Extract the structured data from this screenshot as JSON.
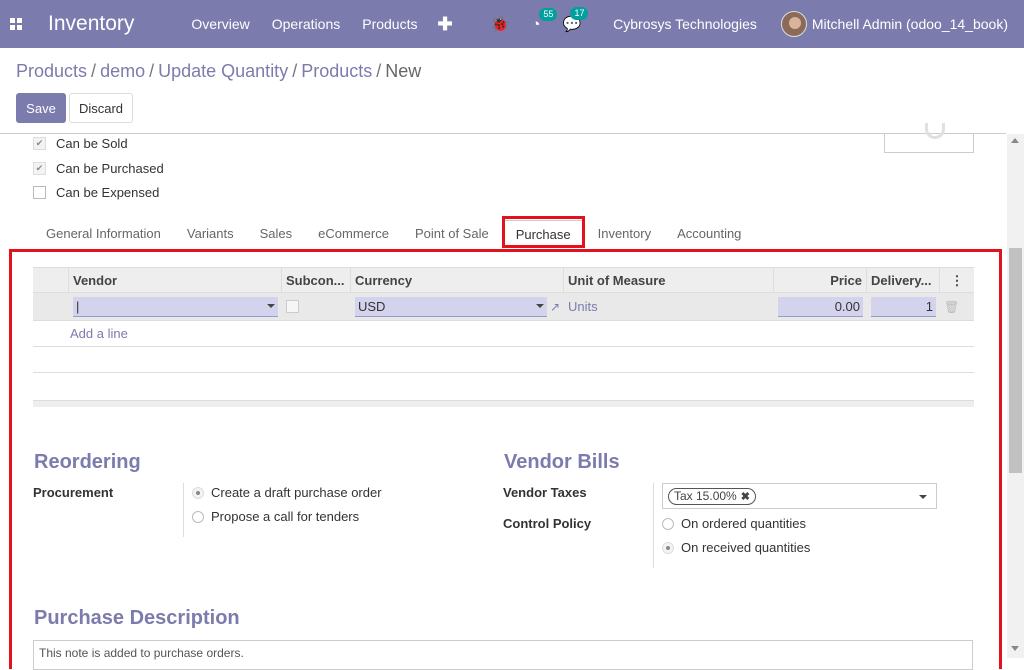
{
  "navbar": {
    "app_name": "Inventory",
    "menu": [
      "Overview",
      "Operations",
      "Products"
    ],
    "plus": "✚",
    "activity_count": "55",
    "messages_count": "17",
    "company": "Cybrosys Technologies",
    "user": "Mitchell Admin (odoo_14_book)"
  },
  "breadcrumb": [
    "Products",
    "demo",
    "Update Quantity",
    "Products",
    "New"
  ],
  "buttons": {
    "save": "Save",
    "discard": "Discard"
  },
  "checkboxes": [
    {
      "label": "Can be Sold",
      "checked": true
    },
    {
      "label": "Can be Purchased",
      "checked": true
    },
    {
      "label": "Can be Expensed",
      "checked": false
    }
  ],
  "tabs": [
    "General Information",
    "Variants",
    "Sales",
    "eCommerce",
    "Point of Sale",
    "Purchase",
    "Inventory",
    "Accounting"
  ],
  "active_tab": "Purchase",
  "vendor_table": {
    "headers": [
      "Vendor",
      "Subcon...",
      "Currency",
      "Unit of Measure",
      "Price",
      "Delivery...",
      "⋮"
    ],
    "row": {
      "vendor": "|",
      "currency": "USD",
      "uom": "Units",
      "price": "0.00",
      "delivery": "1"
    },
    "add_line": "Add a line"
  },
  "reordering": {
    "title": "Reordering",
    "procurement_label": "Procurement",
    "options": [
      {
        "label": "Create a draft purchase order",
        "selected": true
      },
      {
        "label": "Propose a call for tenders",
        "selected": false
      }
    ]
  },
  "vendor_bills": {
    "title": "Vendor Bills",
    "taxes_label": "Vendor Taxes",
    "tax_tag": "Tax 15.00%",
    "control_label": "Control Policy",
    "options": [
      {
        "label": "On ordered quantities",
        "selected": false
      },
      {
        "label": "On received quantities",
        "selected": true
      }
    ]
  },
  "purchase_description": {
    "title": "Purchase Description",
    "placeholder": "This note is added to purchase orders."
  },
  "colors": {
    "brand": "#7c7bad",
    "highlight": "#e3101e",
    "badge": "#00a09d"
  }
}
